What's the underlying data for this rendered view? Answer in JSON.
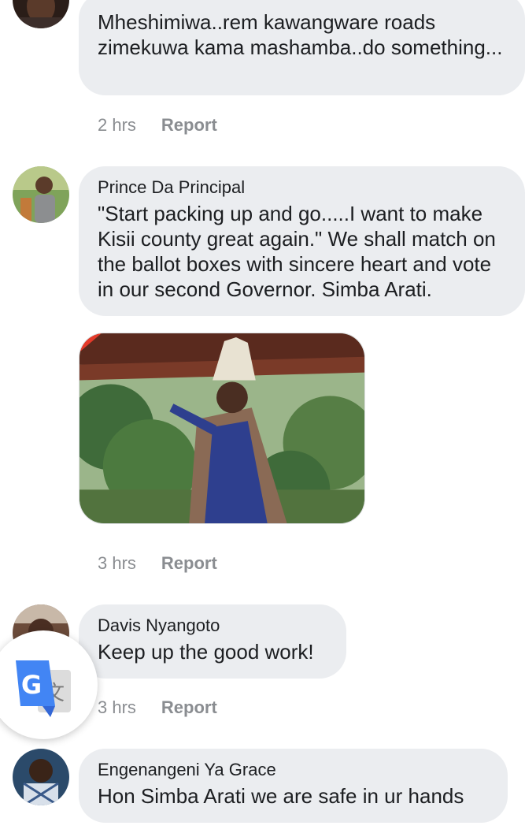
{
  "comments": [
    {
      "author": "",
      "text": "Mheshimiwa..rem kawangware roads zimekuwa kama mashamba..do something...",
      "time": "2 hrs",
      "report": "Report"
    },
    {
      "author": "Prince Da Principal",
      "text": "\"Start packing up and go.....I want to make Kisii county great again.\" We shall match on the ballot boxes with sincere heart and vote in our second Governor. Simba Arati.",
      "time": "3 hrs",
      "report": "Report",
      "has_photo": true
    },
    {
      "author": "Davis Nyangoto",
      "text": "Keep up the good work!",
      "time": "3 hrs",
      "report": "Report"
    },
    {
      "author": "Engenangeni Ya Grace",
      "text": "Hon Simba Arati we are safe in ur hands"
    }
  ],
  "translate_button": {
    "icon": "google-translate-icon"
  },
  "colors": {
    "bubble_bg": "#ebedf0",
    "meta_text": "#8a8d91",
    "google_blue": "#4285f4"
  }
}
